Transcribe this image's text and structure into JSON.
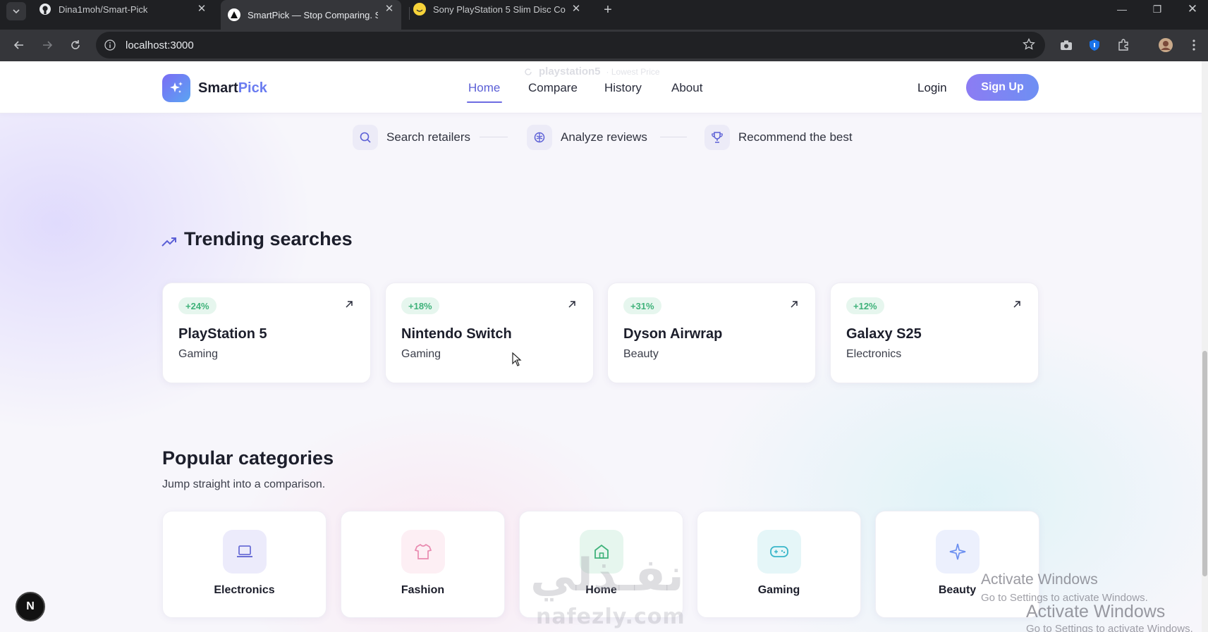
{
  "browser": {
    "tabs": [
      {
        "title": "Dina1moh/Smart-Pick",
        "icon": "github-icon"
      },
      {
        "title": "SmartPick — Stop Comparing. S",
        "icon": "nextjs-icon"
      },
      {
        "title": "Sony PlayStation 5 Slim Disc Co",
        "icon": "smiley-icon"
      }
    ],
    "url": "localhost:3000"
  },
  "header": {
    "logo_main": "Smart",
    "logo_accent": "Pick",
    "ghost_search": "playstation5",
    "ghost_sub": "· Lowest Price",
    "nav": [
      "Home",
      "Compare",
      "History",
      "About"
    ],
    "login": "Login",
    "signup": "Sign Up"
  },
  "steps": [
    "Search retailers",
    "Analyze reviews",
    "Recommend the best"
  ],
  "trending": {
    "title": "Trending searches",
    "items": [
      {
        "badge": "+24%",
        "title": "PlayStation 5",
        "category": "Gaming"
      },
      {
        "badge": "+18%",
        "title": "Nintendo Switch",
        "category": "Gaming"
      },
      {
        "badge": "+31%",
        "title": "Dyson Airwrap",
        "category": "Beauty"
      },
      {
        "badge": "+12%",
        "title": "Galaxy S25",
        "category": "Electronics"
      }
    ]
  },
  "categories": {
    "title": "Popular categories",
    "subtitle": "Jump straight into a comparison.",
    "items": [
      {
        "label": "Electronics",
        "icon": "laptop-icon",
        "color": "#6b6fd6",
        "bg": "#ecebfb"
      },
      {
        "label": "Fashion",
        "icon": "shirt-icon",
        "color": "#e98bb0",
        "bg": "#fdeff4"
      },
      {
        "label": "Home",
        "icon": "home-icon",
        "color": "#3fb27a",
        "bg": "#e6f6ee"
      },
      {
        "label": "Gaming",
        "icon": "gamepad-icon",
        "color": "#39b6c9",
        "bg": "#e5f6f8"
      },
      {
        "label": "Beauty",
        "icon": "sparkle-icon",
        "color": "#6b8ff0",
        "bg": "#ecf0fd"
      }
    ]
  },
  "overlay": {
    "next_badge": "N",
    "watermark_ar": "نفـذلي",
    "watermark_url": "nafezly.com",
    "activate_title": "Activate Windows",
    "activate_sub": "Go to Settings to activate Windows."
  }
}
